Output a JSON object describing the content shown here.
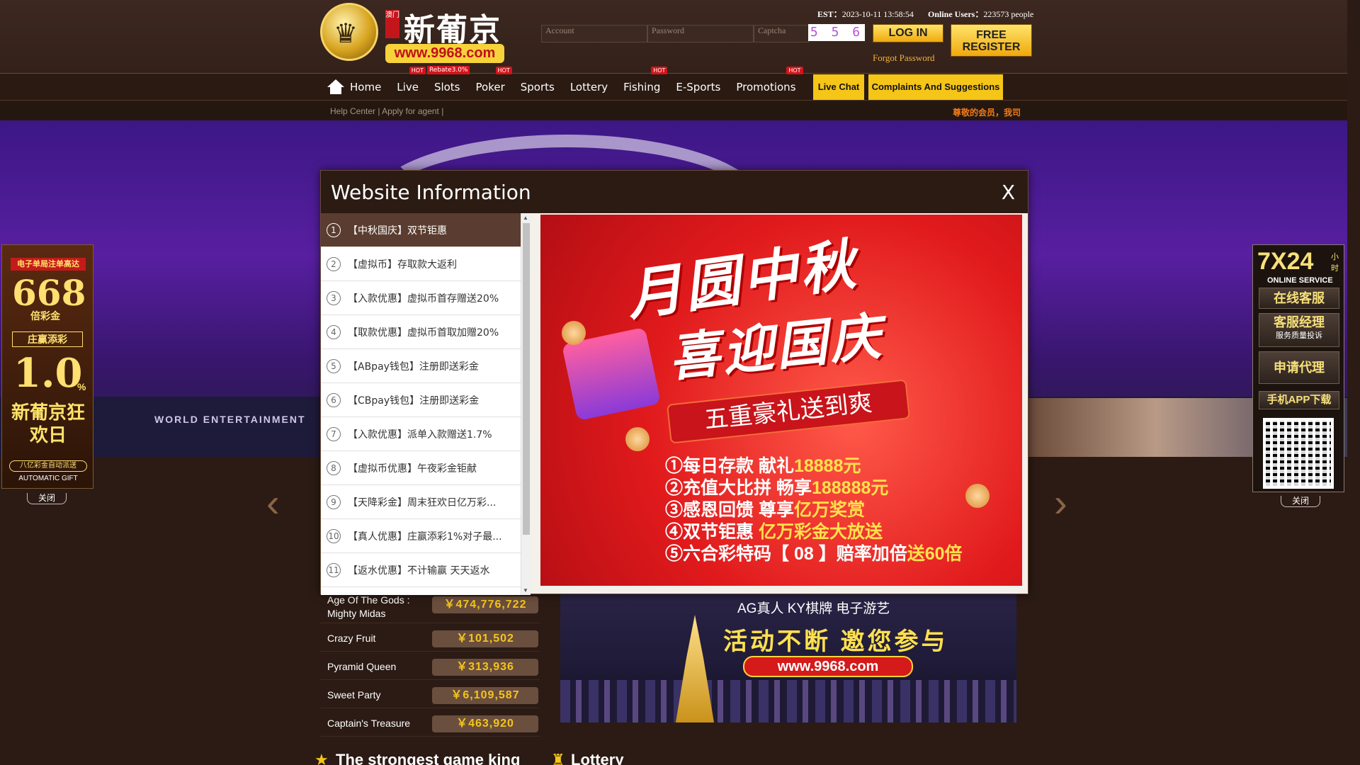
{
  "header": {
    "logo_text": "新葡京",
    "logo_seal": "澳门",
    "logo_url": "www.9968.com",
    "est_label": "EST：",
    "est_value": "2023-10-11 13:58:54",
    "online_label": "Online Users：",
    "online_value": "223573 people",
    "account_placeholder": "Account",
    "password_placeholder": "Password",
    "captcha_placeholder": "Captcha",
    "captcha_code": "5 5 6",
    "login_label": "LOG IN",
    "register_label": "FREE REGISTER",
    "forgot_label": "Forgot Password"
  },
  "nav": {
    "items": [
      {
        "label": "Home"
      },
      {
        "label": "Live",
        "badge": "HOT"
      },
      {
        "label": "Slots",
        "badge": "Rebate3.0%"
      },
      {
        "label": "Poker",
        "badge": "HOT"
      },
      {
        "label": "Sports"
      },
      {
        "label": "Lottery"
      },
      {
        "label": "Fishing",
        "badge": "HOT"
      },
      {
        "label": "E-Sports"
      },
      {
        "label": "Promotions",
        "badge": "HOT"
      }
    ],
    "live_chat": "Live Chat",
    "complaints": "Complaints And Suggestions"
  },
  "subnav": {
    "help": "Help Center",
    "sep1": "|",
    "agent": "Apply for agent",
    "sep2": "|",
    "marquee": "尊敬的会员，我司"
  },
  "banner": {
    "world_entertainment": "WORLD ENTERTAINMENT"
  },
  "left_float": {
    "title": "电子单局注单高达",
    "value": "668",
    "unit": "倍彩金",
    "zhuang": "庄赢添彩",
    "rate": "1.0",
    "pct": "%",
    "festival": "新葡京狂欢日",
    "auto_cn": "八亿彩金自动派送",
    "auto_en": "AUTOMATIC GIFT",
    "close": "关闭"
  },
  "right_float": {
    "hours": "7X24",
    "hours_unit": "小时",
    "online_service_en": "ONLINE SERVICE",
    "online_service_cn": "在线客服",
    "manager": "客服经理",
    "manager_sub": "服务质量投诉",
    "agent": "申请代理",
    "app": "手机APP下载",
    "close": "关闭"
  },
  "modal": {
    "title": "Website Information",
    "close": "X",
    "items": [
      {
        "num": "1",
        "text": "【中秋国庆】双节钜惠"
      },
      {
        "num": "2",
        "text": "【虚拟币】存取款大返利"
      },
      {
        "num": "3",
        "text": "【入款优惠】虚拟币首存赠送20%"
      },
      {
        "num": "4",
        "text": "【取款优惠】虚拟币首取加赠20%"
      },
      {
        "num": "5",
        "text": "【ABpay钱包】注册即送彩金"
      },
      {
        "num": "6",
        "text": "【CBpay钱包】注册即送彩金"
      },
      {
        "num": "7",
        "text": "【入款优惠】派单入款赠送1.7%"
      },
      {
        "num": "8",
        "text": "【虚拟币优惠】午夜彩金钜献"
      },
      {
        "num": "9",
        "text": "【天降彩金】周末狂欢日亿万彩..."
      },
      {
        "num": "10",
        "text": "【真人优惠】庄赢添彩1%对子最..."
      },
      {
        "num": "11",
        "text": "【返水优惠】不计输赢 天天返水"
      }
    ],
    "promo": {
      "line1": "月圆中秋",
      "line2": "喜迎国庆",
      "ribbon": "五重豪礼送到爽",
      "rows": [
        {
          "pre": "①每日存款 献礼",
          "hl": "18888元"
        },
        {
          "pre": "②充值大比拼 畅享",
          "hl": "188888元"
        },
        {
          "pre": "③感恩回馈 尊享",
          "hl": "亿万奖赏"
        },
        {
          "pre": "④双节钜惠 ",
          "hl": "亿万彩金大放送"
        },
        {
          "pre": "⑤六合彩特码【 08 】赔率加倍",
          "hl": "送60倍"
        }
      ]
    }
  },
  "jackpots": [
    {
      "name": "Age Of The Gods : Mighty Midas",
      "value": "￥474,776,722"
    },
    {
      "name": "Crazy Fruit",
      "value": "￥101,502"
    },
    {
      "name": "Pyramid Queen",
      "value": "￥313,936"
    },
    {
      "name": "Sweet Party",
      "value": "￥6,109,587"
    },
    {
      "name": "Captain's Treasure",
      "value": "￥463,920"
    }
  ],
  "promo2": {
    "top": "AG真人   KY棋牌   电子游艺",
    "mid": "活动不断 邀您参与",
    "url": "www.9968.com"
  },
  "sections": {
    "game_king": "The strongest game king",
    "lottery": "Lottery"
  },
  "colors": {
    "accent_gold": "#f5c518",
    "brand_red": "#d4141b",
    "header_bg": "#33211a"
  }
}
